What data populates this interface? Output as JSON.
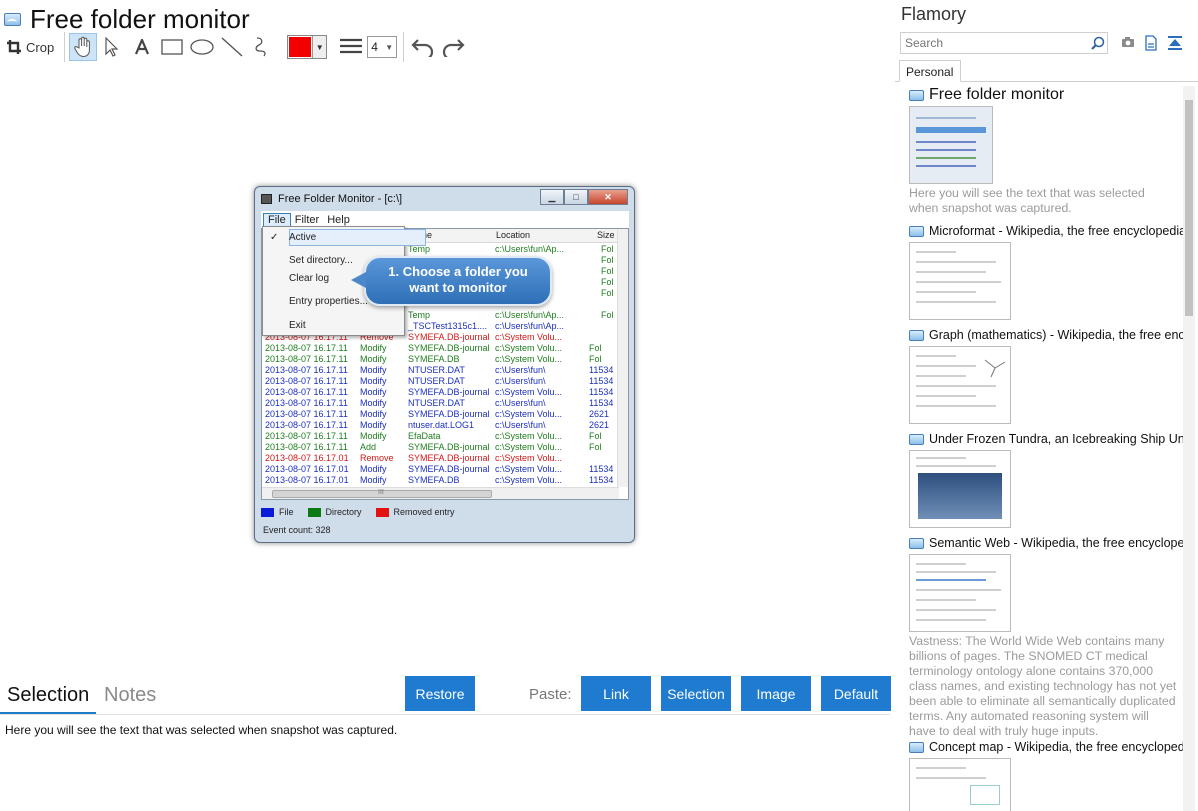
{
  "document": {
    "title": "Free folder monitor"
  },
  "toolbar": {
    "crop_label": "Crop",
    "line_width": "4",
    "pen_color": "#f20000"
  },
  "snapshot": {
    "window_title": "Free Folder Monitor - [c:\\]",
    "menu": [
      "File",
      "Filter",
      "Help"
    ],
    "columns": [
      "Name",
      "Location",
      "Size"
    ],
    "file_menu": {
      "active": "Active",
      "check": "✓",
      "set_directory": "Set directory...",
      "clear_log": "Clear log",
      "entry_properties": "Entry properties...",
      "exit": "Exit"
    },
    "bubble_line1": "1. Choose a folder you",
    "bubble_line2": "want to monitor",
    "partial_rows": [
      {
        "name": "Temp",
        "loc": "c:\\Users\\fun\\Ap...",
        "size": "Fol",
        "cls": "c-dir"
      },
      {
        "name": "",
        "loc": "",
        "size": "Fol",
        "cls": "c-dir"
      },
      {
        "name": "",
        "loc": "",
        "size": "Fol",
        "cls": "c-dir"
      },
      {
        "name": "",
        "loc": "",
        "size": "Fol",
        "cls": "c-dir"
      },
      {
        "name": "",
        "loc": "",
        "size": "Fol",
        "cls": "c-dir"
      },
      {
        "name": "",
        "loc": "",
        "size": "",
        "cls": "c-rem"
      },
      {
        "name": "Temp",
        "loc": "c:\\Users\\fun\\Ap...",
        "size": "Fol",
        "cls": "c-dir"
      },
      {
        "name": "_TSCTest1315c1....",
        "loc": "c:\\Users\\fun\\Ap...",
        "size": "",
        "cls": "c-file"
      }
    ],
    "rows": [
      {
        "time": "2013-08-07 16.17.11",
        "action": "Remove",
        "name": "SYMEFA.DB-journal",
        "loc": "c:\\System Volu...",
        "size": "",
        "cls": "c-rem"
      },
      {
        "time": "2013-08-07 16.17.11",
        "action": "Modify",
        "name": "SYMEFA.DB-journal",
        "loc": "c:\\System Volu...",
        "size": "Fol",
        "cls": "c-dir"
      },
      {
        "time": "2013-08-07 16.17.11",
        "action": "Modify",
        "name": "SYMEFA.DB",
        "loc": "c:\\System Volu...",
        "size": "Fol",
        "cls": "c-dir"
      },
      {
        "time": "2013-08-07 16.17.11",
        "action": "Modify",
        "name": "NTUSER.DAT",
        "loc": "c:\\Users\\fun\\",
        "size": "11534",
        "cls": "c-file"
      },
      {
        "time": "2013-08-07 16.17.11",
        "action": "Modify",
        "name": "NTUSER.DAT",
        "loc": "c:\\Users\\fun\\",
        "size": "11534",
        "cls": "c-file"
      },
      {
        "time": "2013-08-07 16.17.11",
        "action": "Modify",
        "name": "SYMEFA.DB-journal",
        "loc": "c:\\System Volu...",
        "size": "11534",
        "cls": "c-file"
      },
      {
        "time": "2013-08-07 16.17.11",
        "action": "Modify",
        "name": "NTUSER.DAT",
        "loc": "c:\\Users\\fun\\",
        "size": "11534",
        "cls": "c-file"
      },
      {
        "time": "2013-08-07 16.17.11",
        "action": "Modify",
        "name": "SYMEFA.DB-journal",
        "loc": "c:\\System Volu...",
        "size": "2621",
        "cls": "c-file"
      },
      {
        "time": "2013-08-07 16.17.11",
        "action": "Modify",
        "name": "ntuser.dat.LOG1",
        "loc": "c:\\Users\\fun\\",
        "size": "2621",
        "cls": "c-file"
      },
      {
        "time": "2013-08-07 16.17.11",
        "action": "Modify",
        "name": "EfaData",
        "loc": "c:\\System Volu...",
        "size": "Fol",
        "cls": "c-dir"
      },
      {
        "time": "2013-08-07 16.17.11",
        "action": "Add",
        "name": "SYMEFA.DB-journal",
        "loc": "c:\\System Volu...",
        "size": "Fol",
        "cls": "c-dir"
      },
      {
        "time": "2013-08-07 16.17.01",
        "action": "Remove",
        "name": "SYMEFA.DB-journal",
        "loc": "c:\\System Volu...",
        "size": "",
        "cls": "c-rem"
      },
      {
        "time": "2013-08-07 16.17.01",
        "action": "Modify",
        "name": "SYMEFA.DB-journal",
        "loc": "c:\\System Volu...",
        "size": "11534",
        "cls": "c-file"
      },
      {
        "time": "2013-08-07 16.17.01",
        "action": "Modify",
        "name": "SYMEFA.DB",
        "loc": "c:\\System Volu...",
        "size": "11534",
        "cls": "c-file"
      }
    ],
    "hscroll_grip": "III",
    "legend": [
      {
        "label": "File",
        "color": "#0a1ad6"
      },
      {
        "label": "Directory",
        "color": "#0a7a14"
      },
      {
        "label": "Removed entry",
        "color": "#e21212"
      }
    ],
    "status": "Event count: 328"
  },
  "bottom": {
    "tab_selection": "Selection",
    "tab_notes": "Notes",
    "restore_label": "Restore",
    "paste_label": "Paste:",
    "link_label": "Link",
    "selection_label": "Selection",
    "image_label": "Image",
    "default_label": "Default",
    "text": "Here you will see the text that was selected when snapshot was captured."
  },
  "sidebar": {
    "title": "Flamory",
    "search_placeholder": "Search",
    "tab": "Personal",
    "items": [
      {
        "title": "Free folder monitor",
        "desc": "Here you will see the text that was selected when snapshot was captured."
      },
      {
        "title": "Microformat - Wikipedia, the free encyclopedia",
        "desc": ""
      },
      {
        "title": "Graph (mathematics) - Wikipedia, the free encyclopedia",
        "desc": ""
      },
      {
        "title": "Under Frozen Tundra, an Icebreaking Ship Uncovers",
        "desc": ""
      },
      {
        "title": "Semantic Web - Wikipedia, the free encyclopedia",
        "desc": "Vastness: The World Wide Web contains many billions of pages. The SNOMED CT medical terminology ontology alone contains 370,000 class names, and existing technology has not yet been able to eliminate all semantically duplicated terms. Any automated reasoning system will have to deal with truly huge inputs."
      },
      {
        "title": "Concept map - Wikipedia, the free encyclopedia",
        "desc": ""
      }
    ]
  },
  "colors": {
    "accent": "#1e7bd0",
    "tab_underline": "#1e7bc6",
    "file": "#1c2fbf",
    "directory": "#1f7d1f",
    "removed": "#d01818"
  }
}
